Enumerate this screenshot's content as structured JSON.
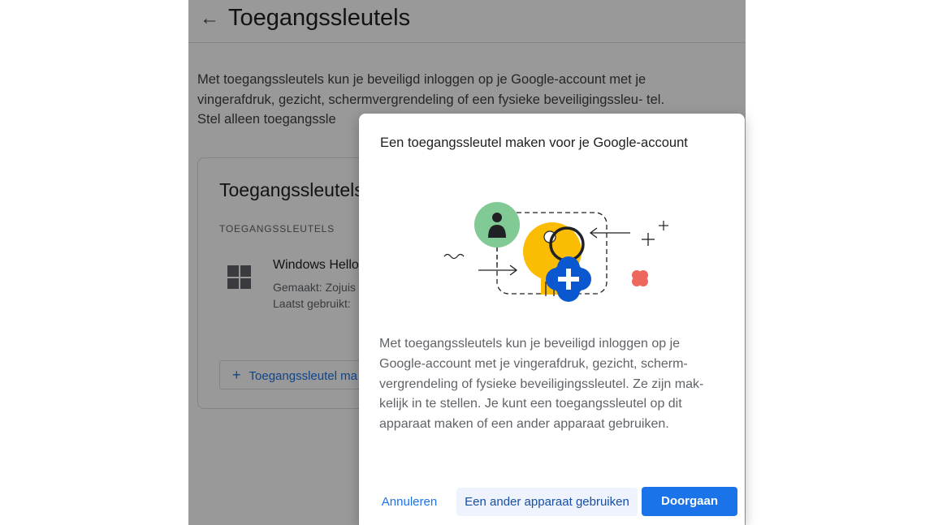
{
  "page": {
    "title": "Toegangssleutels",
    "intro": "Met toegangssleutels kun je beveiligd inloggen op je Google-account met je vingerafdruk, gezicht, schermvergrendeling of een fysieke beveiligingssleu- tel. Stel alleen toegangssle",
    "card": {
      "title": "Toegangssleutels",
      "section_label": "TOEGANGSSLEUTELS",
      "passkey_name": "Windows Hello",
      "created": "Gemaakt: Zojuis",
      "last_used": "Laatst gebruikt:",
      "add_button": "Toegangssleutel ma"
    }
  },
  "dialog": {
    "title": "Een toegangssleutel maken voor je Google-account",
    "body": "Met toegangssleutels kun je beveiligd inloggen op je Google-account met je vingerafdruk, gezicht, scherm-vergrendeling of fysieke beveiligingssleutel. Ze zijn mak-kelijk in te stellen. Je kunt een toegangssleutel op dit apparaat maken of een ander apparaat gebruiken.",
    "cancel_label": "Annuleren",
    "other_device_label": "Een ander apparaat gebruiken",
    "continue_label": "Doorgaan"
  },
  "colors": {
    "accent": "#1a73e8",
    "key_yellow": "#fbbc04",
    "avatar_green": "#81c995",
    "plus_blue": "#0b57d0",
    "dot_red": "#ee675c"
  },
  "icons": [
    "back-arrow-icon",
    "windows-icon",
    "plus-icon",
    "passkey-illustration"
  ]
}
